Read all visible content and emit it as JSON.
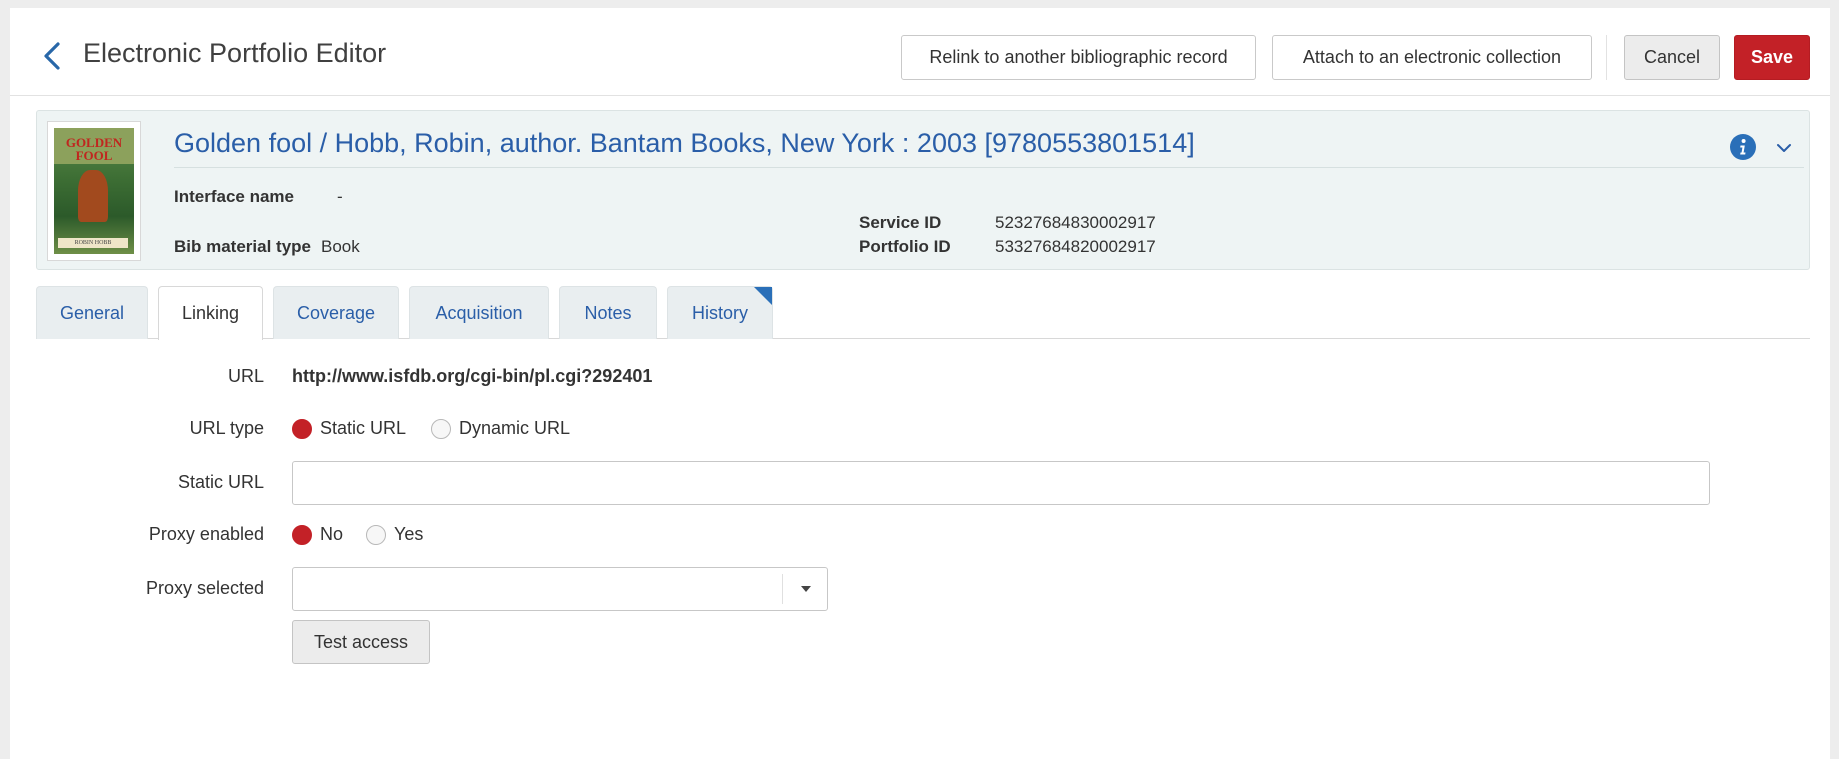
{
  "header": {
    "title": "Electronic Portfolio Editor",
    "relink_label": "Relink to another bibliographic record",
    "attach_label": "Attach to an electronic collection",
    "cancel_label": "Cancel",
    "save_label": "Save"
  },
  "record": {
    "title": "Golden fool / Hobb, Robin, author. Bantam Books, New York : 2003 [9780553801514]",
    "cover_text": {
      "line1": "GOLDEN",
      "line2": "FOOL",
      "author": "ROBIN HOBB"
    },
    "interface_name_label": "Interface name",
    "interface_name_value": "-",
    "bib_material_type_label": "Bib material type",
    "bib_material_type_value": "Book",
    "service_id_label": "Service ID",
    "service_id_value": "52327684830002917",
    "portfolio_id_label": "Portfolio ID",
    "portfolio_id_value": "53327684820002917"
  },
  "tabs": [
    {
      "label": "General",
      "active": false
    },
    {
      "label": "Linking",
      "active": true
    },
    {
      "label": "Coverage",
      "active": false
    },
    {
      "label": "Acquisition",
      "active": false
    },
    {
      "label": "Notes",
      "active": false
    },
    {
      "label": "History",
      "active": false
    }
  ],
  "form": {
    "url_label": "URL",
    "url_value": "http://www.isfdb.org/cgi-bin/pl.cgi?292401",
    "url_type_label": "URL type",
    "url_type_options": [
      "Static URL",
      "Dynamic URL"
    ],
    "url_type_selected": "Static URL",
    "static_url_label": "Static URL",
    "static_url_value": "",
    "proxy_enabled_label": "Proxy enabled",
    "proxy_enabled_options": [
      "No",
      "Yes"
    ],
    "proxy_enabled_selected": "No",
    "proxy_selected_label": "Proxy selected",
    "proxy_selected_value": "",
    "test_access_label": "Test access"
  },
  "colors": {
    "accent_blue": "#2a5ea8",
    "save_red": "#c32127",
    "summary_bg": "#eef4f4"
  },
  "icons": [
    "chevron-left-icon",
    "info-icon",
    "chevron-down-icon",
    "dropdown-arrow-icon"
  ]
}
